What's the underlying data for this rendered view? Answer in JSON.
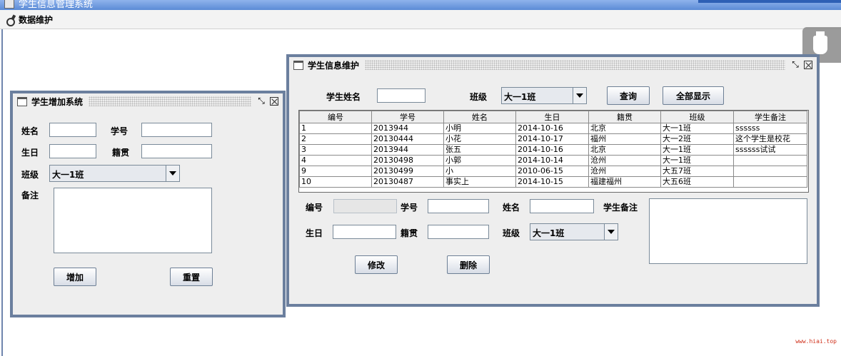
{
  "app": {
    "title": "学生信息管理系统"
  },
  "menu": {
    "data_maintenance": "数据维护"
  },
  "add_frame": {
    "title": "学生增加系统",
    "name_label": "姓名",
    "student_id_label": "学号",
    "birthday_label": "生日",
    "origin_label": "籍贯",
    "class_label": "班级",
    "class_value": "大一1班",
    "remarks_label": "备注",
    "add_button": "增加",
    "reset_button": "重置"
  },
  "maint_frame": {
    "title": "学生信息维护",
    "search_name_label": "学生姓名",
    "search_class_label": "班级",
    "search_class_value": "大一1班",
    "query_button": "查询",
    "show_all_button": "全部显示",
    "table": {
      "columns": [
        "编号",
        "学号",
        "姓名",
        "生日",
        "籍贯",
        "班级",
        "学生备注"
      ],
      "rows": [
        [
          "1",
          "2013944",
          "小明",
          "2014-10-16",
          "北京",
          "大一1班",
          "ssssss"
        ],
        [
          "2",
          "20130444",
          "小花",
          "2014-10-17",
          "福州",
          "大一2班",
          "这个学生是校花"
        ],
        [
          "3",
          "2013944",
          "张五",
          "2014-10-16",
          "北京",
          "大一1班",
          "ssssss试试"
        ],
        [
          "4",
          "20130498",
          "小郭",
          "2014-10-14",
          "沧州",
          "大一1班",
          ""
        ],
        [
          "9",
          "20130499",
          "小",
          "2010-06-15",
          "沧州",
          "大五7班",
          ""
        ],
        [
          "10",
          "20130487",
          "事实上",
          "2014-10-15",
          "福建福州",
          "大五6班",
          ""
        ]
      ]
    },
    "form": {
      "id_label": "编号",
      "student_id_label": "学号",
      "name_label": "姓名",
      "remarks_label": "学生备注",
      "birthday_label": "生日",
      "origin_label": "籍贯",
      "class_label": "班级",
      "class_value": "大一1班",
      "modify_button": "修改",
      "delete_button": "删除"
    }
  },
  "watermark": "www.hiai.top"
}
